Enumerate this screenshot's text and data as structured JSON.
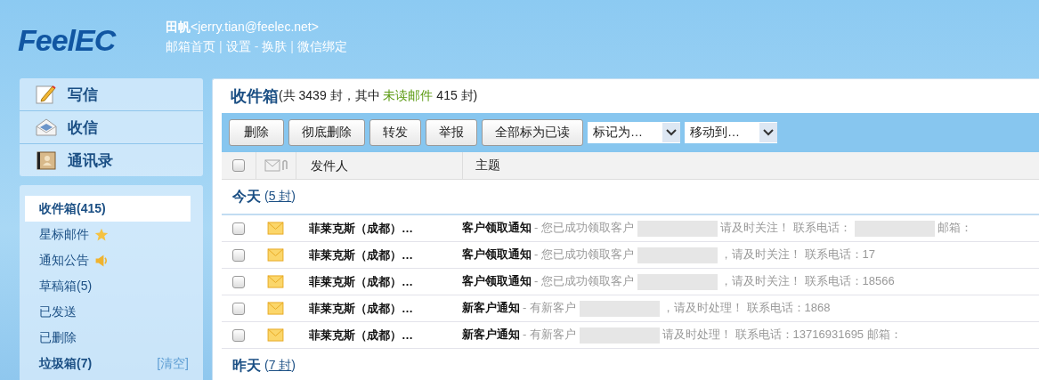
{
  "logo": "FeelEC",
  "user": {
    "name": "田帆",
    "email": "<jerry.tian@feelec.net>"
  },
  "nav": [
    {
      "kind": "link",
      "text": "邮箱首页"
    },
    {
      "kind": "sep",
      "text": "|"
    },
    {
      "kind": "link",
      "text": "设置"
    },
    {
      "kind": "sep",
      "text": "-"
    },
    {
      "kind": "link",
      "text": "换肤"
    },
    {
      "kind": "sep",
      "text": "|"
    },
    {
      "kind": "link",
      "text": "微信绑定"
    }
  ],
  "actions": [
    {
      "label": "写信",
      "kind": "compose"
    },
    {
      "label": "收信",
      "kind": "receive"
    },
    {
      "label": "通讯录",
      "kind": "contacts"
    }
  ],
  "folders": [
    {
      "label": "收件箱(415)",
      "selected": true,
      "unread": true
    },
    {
      "label": "星标邮件",
      "selected": false,
      "unread": false,
      "kind": "star"
    },
    {
      "label": "通知公告",
      "selected": false,
      "unread": false,
      "kind": "speaker"
    },
    {
      "label": "草稿箱(5)",
      "selected": false,
      "unread": false
    },
    {
      "label": "已发送",
      "selected": false,
      "unread": false
    },
    {
      "label": "已删除",
      "selected": false,
      "unread": false
    },
    {
      "label": "垃圾箱(7)",
      "selected": false,
      "unread": true,
      "action": "[清空]"
    }
  ],
  "mailbox": {
    "title": "收件箱",
    "summary_start": "(共 3439 封，其中 ",
    "unread_label": "未读邮件",
    "summary_end": " 415 封)"
  },
  "toolbar": {
    "buttons": [
      "删除",
      "彻底删除",
      "转发",
      "举报",
      "全部标为已读"
    ],
    "dropdowns": [
      "标记为…",
      "移动到…"
    ]
  },
  "columns": [
    "发件人",
    "主题"
  ],
  "select_all": {
    "checked": false
  },
  "groups": [
    {
      "label": "今天",
      "open": "(",
      "count": "5 封",
      "close": ")",
      "rows": [
        {
          "checked": false,
          "sender": "菲莱克斯（成都）…",
          "subject": "客户领取通知",
          "preview_parts": [
            "- 您已成功领取客户",
            "请及时关注！ 联系电话：",
            "邮箱："
          ]
        },
        {
          "checked": false,
          "sender": "菲莱克斯（成都）…",
          "subject": "客户领取通知",
          "preview_parts": [
            "- 您已成功领取客户",
            "，请及时关注！ 联系电话：17"
          ]
        },
        {
          "checked": false,
          "sender": "菲莱克斯（成都）…",
          "subject": "客户领取通知",
          "preview_parts": [
            "- 您已成功领取客户",
            "，请及时关注！ 联系电话：18566"
          ]
        },
        {
          "checked": false,
          "sender": "菲莱克斯（成都）…",
          "subject": "新客户通知",
          "preview_parts": [
            "- 有新客户",
            "，请及时处理！ 联系电话：1868"
          ]
        },
        {
          "checked": false,
          "sender": "菲莱克斯（成都）…",
          "subject": "新客户通知",
          "preview_parts": [
            "- 有新客户",
            "请及时处理！ 联系电话：13716931695 邮箱："
          ]
        }
      ]
    },
    {
      "label": "昨天",
      "open": "(",
      "count": "7 封",
      "close": ")"
    }
  ]
}
